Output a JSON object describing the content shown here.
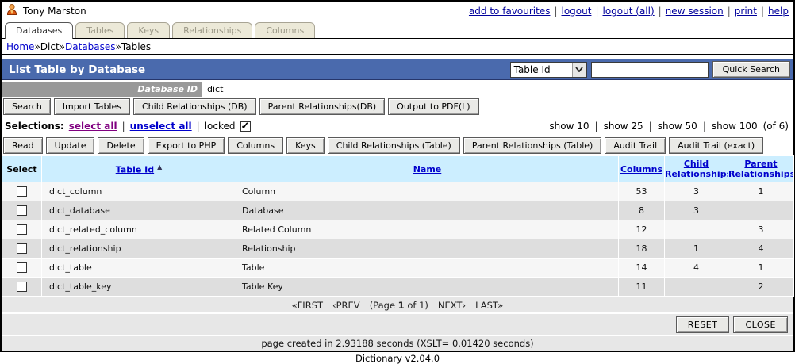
{
  "header": {
    "user_name": "Tony Marston",
    "links": [
      "add to favourites",
      "logout",
      "logout (all)",
      "new session",
      "print",
      "help"
    ],
    "separator": "|"
  },
  "tabs": [
    {
      "label": "Databases",
      "active": true
    },
    {
      "label": "Tables",
      "active": false
    },
    {
      "label": "Keys",
      "active": false
    },
    {
      "label": "Relationships",
      "active": false
    },
    {
      "label": "Columns",
      "active": false
    }
  ],
  "breadcrumb": {
    "separator": "»",
    "items": [
      {
        "label": "Home",
        "link": true
      },
      {
        "label": "Dict",
        "link": false
      },
      {
        "label": "Databases",
        "link": true
      },
      {
        "label": "Tables",
        "link": false
      }
    ]
  },
  "title_bar": {
    "title": "List Table by Database",
    "quick_search": {
      "field_selected": "Table Id",
      "input_value": "",
      "button_label": "Quick Search"
    }
  },
  "database_id": {
    "label": "Database ID",
    "value": "dict"
  },
  "toolbar_top": [
    "Search",
    "Import Tables",
    "Child Relationships (DB)",
    "Parent Relationships(DB)",
    "Output to PDF(L)"
  ],
  "selections": {
    "label": "Selections:",
    "select_all": "select all",
    "unselect_all": "unselect all",
    "locked_label": "locked",
    "locked_checked": true,
    "separator": "|"
  },
  "show_options": {
    "items": [
      "show 10",
      "show 25",
      "show 50",
      "show 100"
    ],
    "suffix": "(of 6)",
    "separator": "|"
  },
  "toolbar_actions": [
    "Read",
    "Update",
    "Delete",
    "Export to PHP",
    "Columns",
    "Keys",
    "Child Relationships (Table)",
    "Parent Relationships (Table)",
    "Audit Trail",
    "Audit Trail (exact)"
  ],
  "table": {
    "headers": {
      "select": "Select",
      "table_id": "Table Id",
      "name": "Name",
      "columns": "Columns",
      "child": "Child Relationships",
      "parent": "Parent Relationships",
      "sort_asc_icon": "▲"
    },
    "rows": [
      {
        "table_id": "dict_column",
        "name": "Column",
        "columns": "53",
        "child": "3",
        "parent": "1"
      },
      {
        "table_id": "dict_database",
        "name": "Database",
        "columns": "8",
        "child": "3",
        "parent": ""
      },
      {
        "table_id": "dict_related_column",
        "name": "Related Column",
        "columns": "12",
        "child": "",
        "parent": "3"
      },
      {
        "table_id": "dict_relationship",
        "name": "Relationship",
        "columns": "18",
        "child": "1",
        "parent": "4"
      },
      {
        "table_id": "dict_table",
        "name": "Table",
        "columns": "14",
        "child": "4",
        "parent": "1"
      },
      {
        "table_id": "dict_table_key",
        "name": "Table Key",
        "columns": "11",
        "child": "",
        "parent": "2"
      }
    ]
  },
  "pagination": {
    "first": "«FIRST",
    "prev": "‹PREV",
    "page_prefix": "(Page",
    "page_current": "1",
    "page_suffix": "of 1)",
    "next": "NEXT›",
    "last": "LAST»"
  },
  "footer_buttons": {
    "reset": "RESET",
    "close": "CLOSE"
  },
  "footer": {
    "timing": "page created in 2.93188 seconds (XSLT= 0.01420 seconds)",
    "version": "Dictionary v2.04.0"
  },
  "colors": {
    "title_bar_bg": "#4a6aad",
    "table_header_bg": "#cceeff",
    "row_alt_bg": "#dedede",
    "tab_inactive_bg": "#ece9d8",
    "link_blue": "#0000cc",
    "visited_purple": "#800080",
    "dbid_bar_grey": "#999999"
  }
}
